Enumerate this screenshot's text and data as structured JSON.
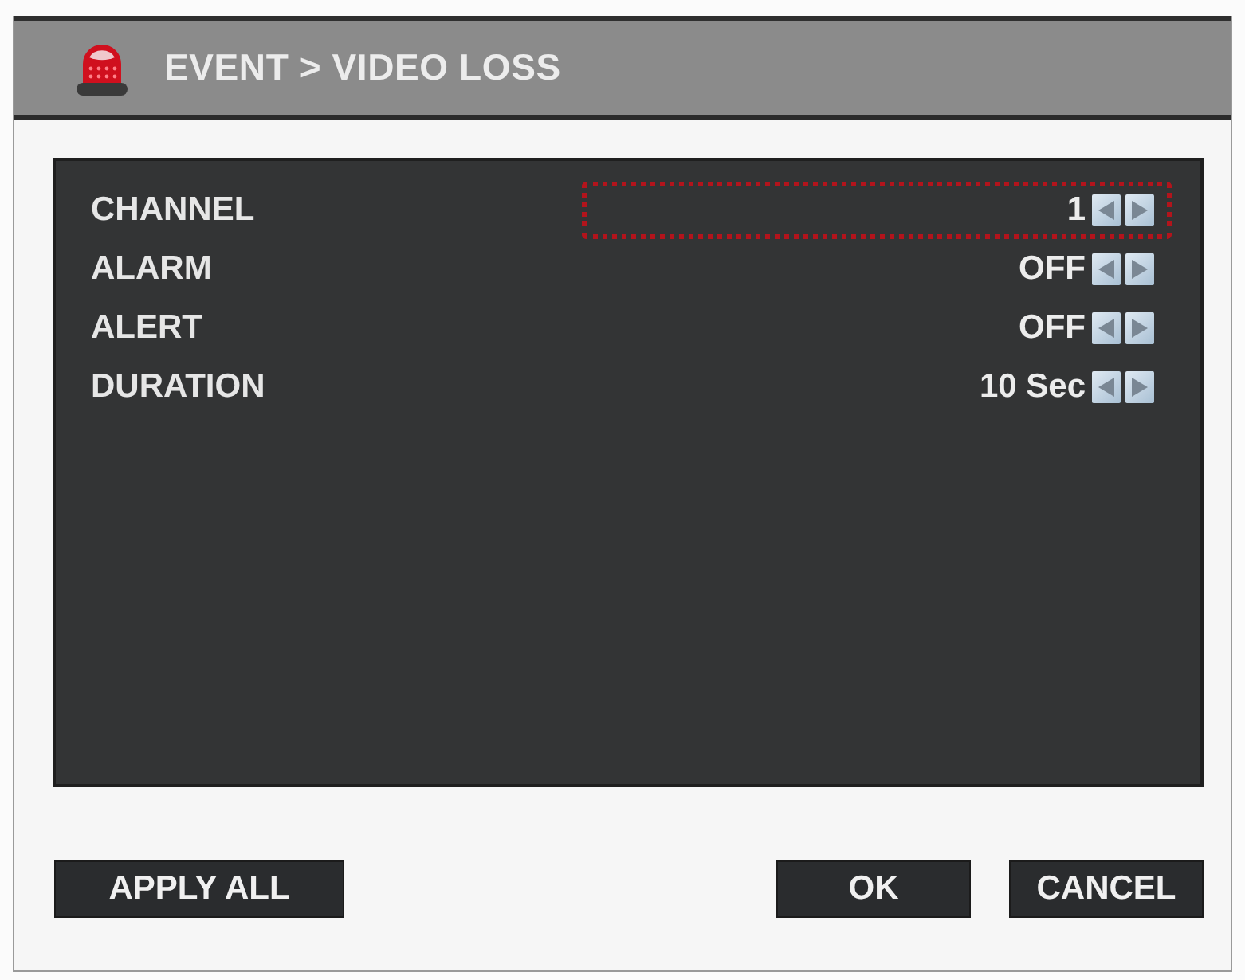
{
  "window": {
    "title": "EVENT > VIDEO LOSS"
  },
  "settings": [
    {
      "label": "CHANNEL",
      "value": "1",
      "selected": true
    },
    {
      "label": "ALARM",
      "value": "OFF",
      "selected": false
    },
    {
      "label": "ALERT",
      "value": "OFF",
      "selected": false
    },
    {
      "label": "DURATION",
      "value": "10 Sec",
      "selected": false
    }
  ],
  "buttons": [
    {
      "label": "APPLY ALL",
      "kind": "left"
    },
    {
      "label": "OK",
      "kind": "right"
    },
    {
      "label": "CANCEL",
      "kind": "right"
    }
  ]
}
